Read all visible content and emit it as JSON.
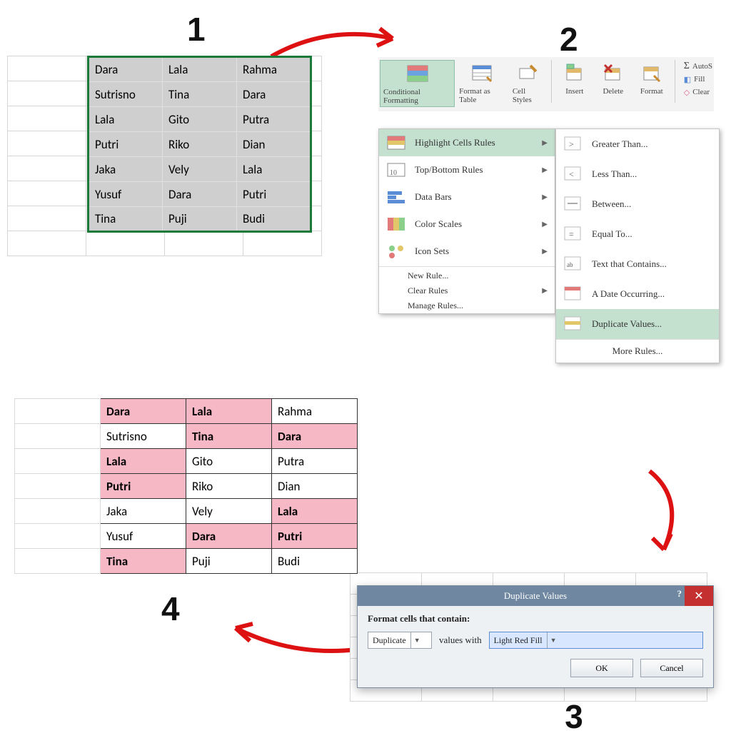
{
  "steps": {
    "s1": "1",
    "s2": "2",
    "s3": "3",
    "s4": "4"
  },
  "table": {
    "rows": [
      [
        "Dara",
        "Lala",
        "Rahma"
      ],
      [
        "Sutrisno",
        "Tina",
        "Dara"
      ],
      [
        "Lala",
        "Gito",
        "Putra"
      ],
      [
        "Putri",
        "Riko",
        "Dian"
      ],
      [
        "Jaka",
        "Vely",
        "Lala"
      ],
      [
        "Yusuf",
        "Dara",
        "Putri"
      ],
      [
        "Tina",
        "Puji",
        "Budi"
      ]
    ],
    "dup": [
      [
        true,
        true,
        false
      ],
      [
        false,
        true,
        true
      ],
      [
        true,
        false,
        false
      ],
      [
        true,
        false,
        false
      ],
      [
        false,
        false,
        true
      ],
      [
        false,
        true,
        true
      ],
      [
        true,
        false,
        false
      ]
    ]
  },
  "ribbon": {
    "cond_fmt": "Conditional Formatting",
    "fmt_table": "Format as Table",
    "cell_styles": "Cell Styles",
    "insert": "Insert",
    "delete": "Delete",
    "format": "Format",
    "autosum": "AutoS",
    "fill": "Fill",
    "clear": "Clear"
  },
  "menu": {
    "highlight": "Highlight Cells Rules",
    "topbottom": "Top/Bottom Rules",
    "databars": "Data Bars",
    "colorscales": "Color Scales",
    "iconsets": "Icon Sets",
    "newrule": "New Rule...",
    "clearrules": "Clear Rules",
    "manage": "Manage Rules..."
  },
  "submenu": {
    "gt": "Greater Than...",
    "lt": "Less Than...",
    "between": "Between...",
    "equal": "Equal To...",
    "text": "Text that Contains...",
    "date": "A Date Occurring...",
    "dup": "Duplicate Values...",
    "more": "More Rules..."
  },
  "dialog": {
    "title": "Duplicate Values",
    "label_contain": "Format cells that contain:",
    "combo1": "Duplicate",
    "values_with": "values with",
    "combo2": "Light Red Fill",
    "ok": "OK",
    "cancel": "Cancel"
  }
}
